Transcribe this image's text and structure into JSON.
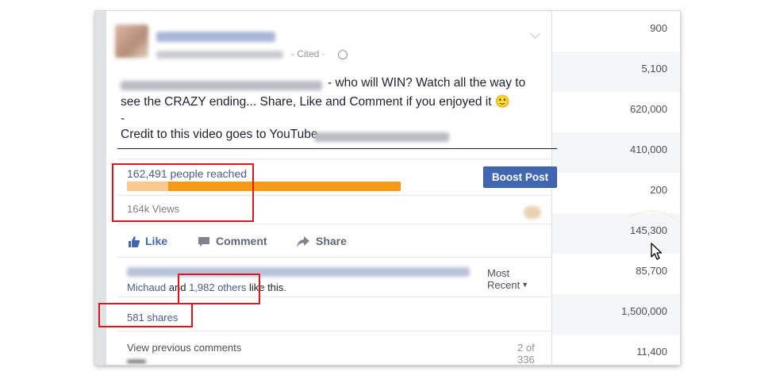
{
  "post": {
    "meta_visible": "- Cited ·",
    "text_line1": "- who will WIN? Watch all the way to",
    "text_line2": "see the CRAZY ending... Share, Like and Comment if you enjoyed it 🙂",
    "text_line3": "-",
    "text_line4": "Credit to this video goes to YouTube",
    "reach_label": "162,491 people reached",
    "reach_organic_fraction": 0.15,
    "boost_label": "Boost Post",
    "views_label": "164k Views",
    "like_label": "Like",
    "comment_label": "Comment",
    "share_label": "Share",
    "sort_label": "Most Recent",
    "likes_name": "Michaud",
    "likes_and": " and ",
    "likes_others": "1,982 others",
    "likes_suffix": " like this.",
    "shares_label": "581 shares",
    "view_previous_label": "View previous comments",
    "comment_count": "2 of 336"
  },
  "stats_column": [
    "900",
    "5,100",
    "620,000",
    "410,000",
    "200",
    "145,300",
    "85,700",
    "1,500,000",
    "11,400"
  ],
  "colors": {
    "accent": "#4267b2",
    "reach_bar": "#f49a14",
    "highlight": "#e3151a"
  }
}
